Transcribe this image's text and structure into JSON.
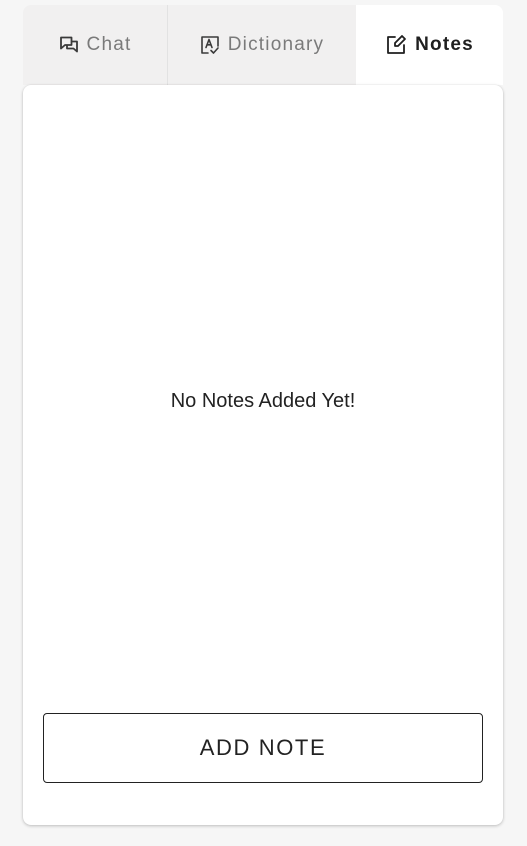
{
  "tabs": [
    {
      "label": "Chat",
      "icon": "chat-bubbles-icon",
      "active": false
    },
    {
      "label": "Dictionary",
      "icon": "spellcheck-icon",
      "active": false
    },
    {
      "label": "Notes",
      "icon": "edit-note-icon",
      "active": true
    }
  ],
  "notes": {
    "empty_message": "No Notes Added Yet!",
    "add_button_label": "ADD NOTE"
  },
  "colors": {
    "page_background": "#f6f6f6",
    "inactive_tab_background": "#f1f0f0",
    "active_tab_background": "#ffffff",
    "inactive_tab_text": "#7a7a7a",
    "text": "#222222"
  }
}
